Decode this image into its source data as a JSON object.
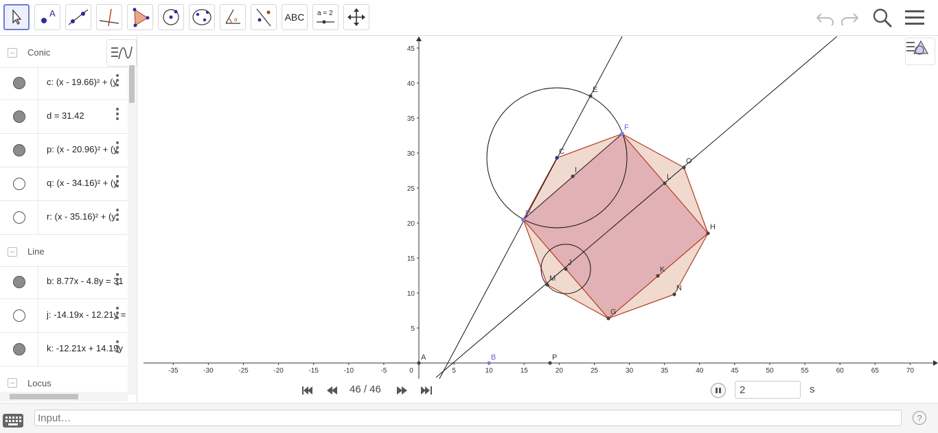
{
  "toolbar": {
    "tools": [
      {
        "name": "move-tool-icon"
      },
      {
        "name": "point-tool-icon"
      },
      {
        "name": "line-tool-icon"
      },
      {
        "name": "perpendicular-line-tool-icon"
      },
      {
        "name": "polygon-tool-icon"
      },
      {
        "name": "circle-center-point-tool-icon"
      },
      {
        "name": "ellipse-tool-icon"
      },
      {
        "name": "angle-tool-icon"
      },
      {
        "name": "reflect-tool-icon"
      },
      {
        "name": "text-tool-icon",
        "label": "ABC"
      },
      {
        "name": "slider-tool-icon",
        "label": "a = 2"
      },
      {
        "name": "move-graphics-view-tool-icon"
      }
    ],
    "right": [
      "undo-icon",
      "redo-icon",
      "search-icon",
      "menu-icon"
    ]
  },
  "algebra": {
    "groups": {
      "conic": "Conic",
      "line": "Line",
      "locus": "Locus"
    },
    "rows": {
      "c": {
        "text": "c: (x - 19.66)² + (y",
        "visible": true
      },
      "d": {
        "text": "d = 31.42",
        "visible": true
      },
      "p": {
        "text": "p: (x - 20.96)² + (y",
        "visible": true
      },
      "q": {
        "text": "q: (x - 34.16)² + (y",
        "visible": false
      },
      "r": {
        "text": "r: (x - 35.16)² + (y",
        "visible": false
      },
      "b": {
        "text": "b: 8.77x - 4.8y = 31",
        "visible": true
      },
      "j": {
        "text": "j: -14.19x - 12.21y =",
        "visible": false
      },
      "k": {
        "text": "k: -12.21x + 14.19y",
        "visible": true
      }
    }
  },
  "graphics": {
    "x_ticks": [
      "-35",
      "-30",
      "-25",
      "-20",
      "-15",
      "-10",
      "-5",
      "0",
      "5",
      "10",
      "15",
      "20",
      "25",
      "30",
      "35",
      "40",
      "45",
      "50",
      "55",
      "60",
      "65",
      "70"
    ],
    "y_ticks": [
      "5",
      "10",
      "15",
      "20",
      "25",
      "30",
      "35",
      "40",
      "45"
    ],
    "points": {
      "A": "A",
      "B": "B",
      "P": "P",
      "C": "C",
      "E": "E",
      "F": "F",
      "O": "O",
      "I": "I",
      "L": "L",
      "H": "H",
      "D": "D",
      "J": "J",
      "K": "K",
      "M": "M",
      "N": "N",
      "G": "G"
    },
    "colors": {
      "polygon_fill_outer": "#f0d9cf",
      "polygon_fill_inner": "#dfa9b0",
      "polygon_stroke": "#b23a1e",
      "free_point": "#6666d8"
    }
  },
  "animation": {
    "frame": "46 / 46",
    "speed_value": "2",
    "speed_unit": "s"
  },
  "input": {
    "placeholder": "Input…",
    "help": "?"
  }
}
